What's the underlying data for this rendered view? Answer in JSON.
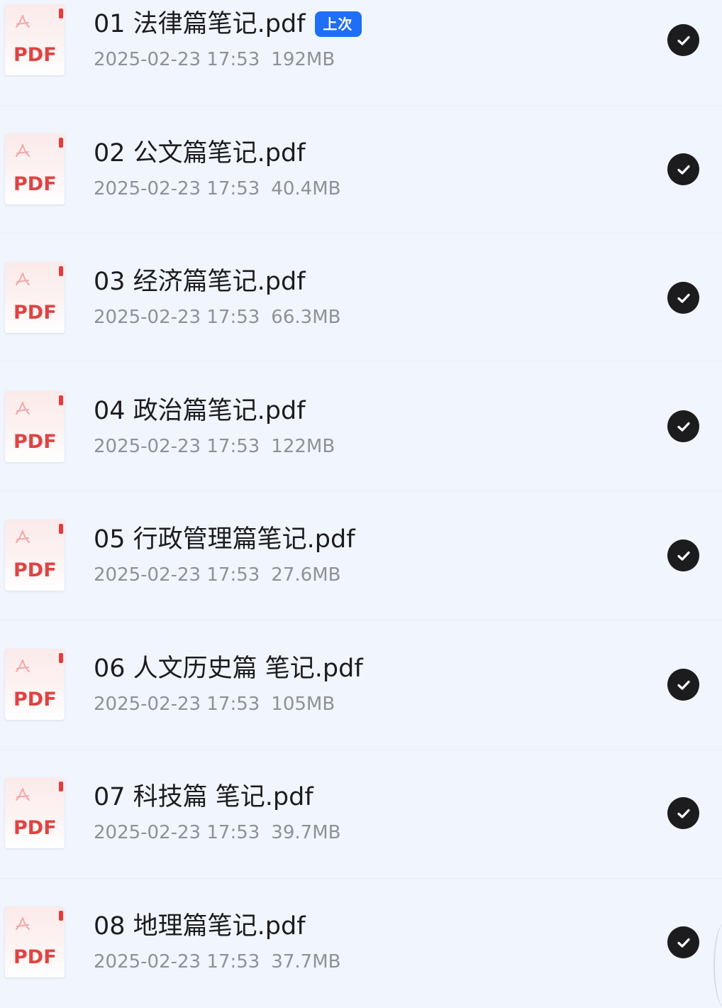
{
  "files": [
    {
      "name": "01 法律篇笔记.pdf",
      "date": "2025-02-23 17:53",
      "size": "192MB",
      "badge": "上次",
      "checked": true,
      "icon": "pdf-file-icon"
    },
    {
      "name": "02 公文篇笔记.pdf",
      "date": "2025-02-23 17:53",
      "size": "40.4MB",
      "badge": "",
      "checked": true,
      "icon": "pdf-file-icon"
    },
    {
      "name": "03 经济篇笔记.pdf",
      "date": "2025-02-23 17:53",
      "size": "66.3MB",
      "badge": "",
      "checked": true,
      "icon": "pdf-file-icon"
    },
    {
      "name": "04 政治篇笔记.pdf",
      "date": "2025-02-23 17:53",
      "size": "122MB",
      "badge": "",
      "checked": true,
      "icon": "pdf-file-icon"
    },
    {
      "name": "05 行政管理篇笔记.pdf",
      "date": "2025-02-23 17:53",
      "size": "27.6MB",
      "badge": "",
      "checked": true,
      "icon": "pdf-file-icon"
    },
    {
      "name": "06 人文历史篇 笔记.pdf",
      "date": "2025-02-23 17:53",
      "size": "105MB",
      "badge": "",
      "checked": true,
      "icon": "pdf-file-icon"
    },
    {
      "name": "07 科技篇 笔记.pdf",
      "date": "2025-02-23 17:53",
      "size": "39.7MB",
      "badge": "",
      "checked": true,
      "icon": "pdf-file-icon"
    },
    {
      "name": "08 地理篇笔记.pdf",
      "date": "2025-02-23 17:53",
      "size": "37.7MB",
      "badge": "",
      "checked": true,
      "icon": "pdf-file-icon"
    }
  ],
  "icon_label": "PDF",
  "colors": {
    "background": "#f1f5fe",
    "badge": "#1f6ef5",
    "pdf_red": "#e04343",
    "check": "#1c1c1e"
  }
}
